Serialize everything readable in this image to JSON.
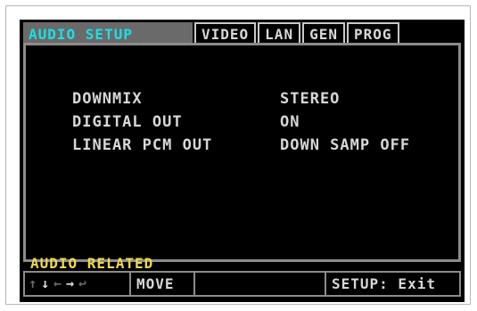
{
  "tabs": [
    {
      "label": "AUDIO SETUP",
      "active": true
    },
    {
      "label": "VIDEO",
      "active": false
    },
    {
      "label": "LAN",
      "active": false
    },
    {
      "label": "GEN",
      "active": false
    },
    {
      "label": "PROG",
      "active": false
    }
  ],
  "settings": [
    {
      "label": "DOWNMIX",
      "value": "STEREO"
    },
    {
      "label": "DIGITAL OUT",
      "value": "ON"
    },
    {
      "label": "LINEAR PCM OUT",
      "value": "DOWN SAMP OFF"
    }
  ],
  "hint": "AUDIO RELATED",
  "statusbar": {
    "arrows": [
      {
        "glyph": "↑",
        "name": "up-arrow-icon",
        "lit": false
      },
      {
        "glyph": "↓",
        "name": "down-arrow-icon",
        "lit": true
      },
      {
        "glyph": "←",
        "name": "left-arrow-icon",
        "lit": false
      },
      {
        "glyph": "→",
        "name": "right-arrow-icon",
        "lit": true
      },
      {
        "glyph": "↩",
        "name": "return-icon",
        "lit": false
      }
    ],
    "move_label": "MOVE",
    "exit_label": "SETUP: Exit"
  },
  "colors": {
    "active_tab_text": "#19e0e8",
    "hint_text": "#f0d84a",
    "text": "#d8d8d8",
    "background": "#000000"
  }
}
